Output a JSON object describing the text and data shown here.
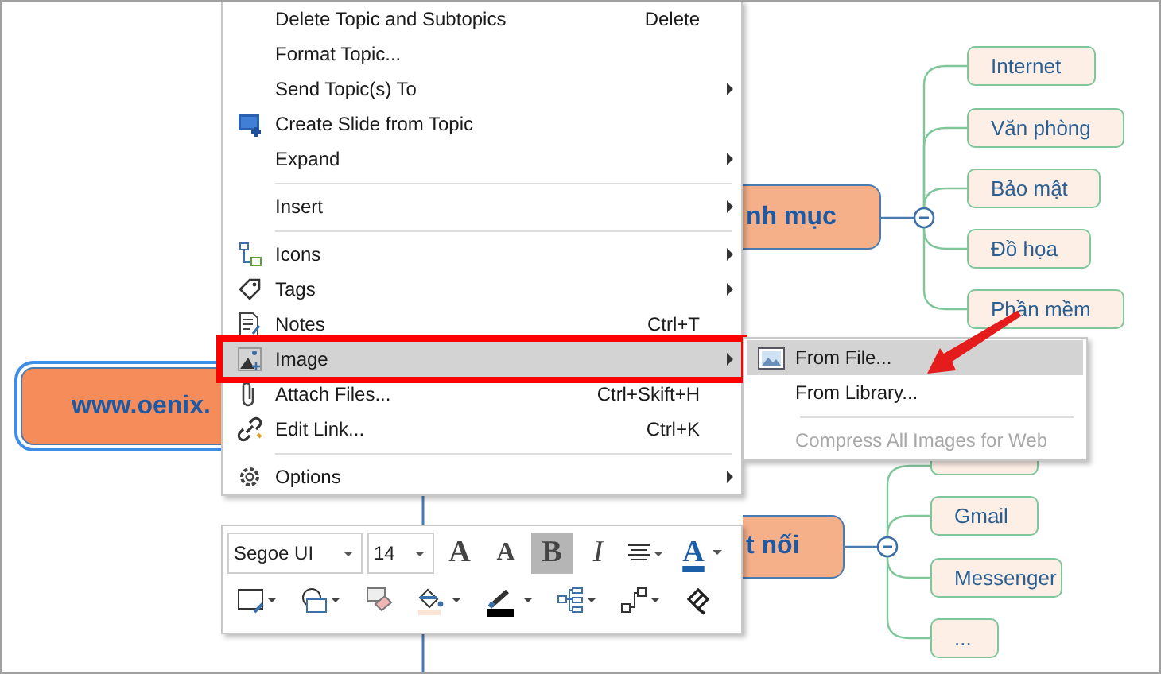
{
  "mind_map": {
    "central_topic": {
      "text": "www.oenix.",
      "selected": true
    },
    "branches": [
      {
        "text": "nh mục",
        "expanded": true,
        "subtopics": [
          {
            "text": "Internet"
          },
          {
            "text": "Văn phòng"
          },
          {
            "text": "Bảo mật"
          },
          {
            "text": "Đồ họa"
          },
          {
            "text": "Phần mềm"
          }
        ]
      },
      {
        "text": "t nối",
        "expanded": true,
        "subtopics": [
          {
            "kind": "covered"
          },
          {
            "text": "Gmail"
          },
          {
            "text": "Messenger"
          },
          {
            "text": "..."
          }
        ]
      }
    ]
  },
  "context_menu": {
    "items": [
      {
        "kind": "item",
        "label": "Delete Topic and Subtopics",
        "shortcut": "Delete",
        "submenu": false,
        "selected": false
      },
      {
        "kind": "item",
        "label": "Format Topic...",
        "submenu": false,
        "selected": false
      },
      {
        "kind": "item",
        "label": "Send Topic(s) To",
        "submenu": true,
        "selected": false
      },
      {
        "kind": "item",
        "label": "Create Slide from Topic",
        "submenu": false,
        "selected": false
      },
      {
        "kind": "item",
        "label": "Expand",
        "submenu": true,
        "selected": false
      },
      {
        "kind": "separator"
      },
      {
        "kind": "item",
        "label": "Insert",
        "submenu": true,
        "selected": false
      },
      {
        "kind": "separator"
      },
      {
        "kind": "item",
        "label": "Icons",
        "submenu": true,
        "selected": false
      },
      {
        "kind": "item",
        "label": "Tags",
        "submenu": true,
        "selected": false
      },
      {
        "kind": "item",
        "label": "Notes",
        "shortcut": "Ctrl+T",
        "submenu": false,
        "selected": false
      },
      {
        "kind": "item",
        "label": "Image",
        "submenu": true,
        "selected": true,
        "highlighted": true
      },
      {
        "kind": "item",
        "label": "Attach Files...",
        "shortcut": "Ctrl+Skift+H",
        "submenu": false,
        "selected": false
      },
      {
        "kind": "item",
        "label": "Edit Link...",
        "shortcut": "Ctrl+K",
        "submenu": false,
        "selected": false
      },
      {
        "kind": "separator"
      },
      {
        "kind": "item",
        "label": "Options",
        "submenu": true,
        "selected": false
      }
    ]
  },
  "submenu": {
    "items": [
      {
        "kind": "item",
        "label": "From File...",
        "selected": true,
        "disabled": false
      },
      {
        "kind": "item",
        "label": "From Library...",
        "selected": false,
        "disabled": false
      },
      {
        "kind": "separator"
      },
      {
        "kind": "item",
        "label": "Compress All Images for Web",
        "selected": false,
        "disabled": true
      }
    ]
  },
  "mini_toolbar": {
    "font": "Segoe UI",
    "size": "14",
    "buttons": [
      {
        "kind": "grow",
        "label": "A"
      },
      {
        "kind": "shrink",
        "label": "A"
      },
      {
        "kind": "bold",
        "label": "B",
        "on": true
      },
      {
        "kind": "italic",
        "label": "I",
        "on": false
      },
      {
        "kind": "align"
      },
      {
        "kind": "font-color",
        "label": "A"
      }
    ]
  },
  "annotation": {
    "kind": "arrow"
  }
}
